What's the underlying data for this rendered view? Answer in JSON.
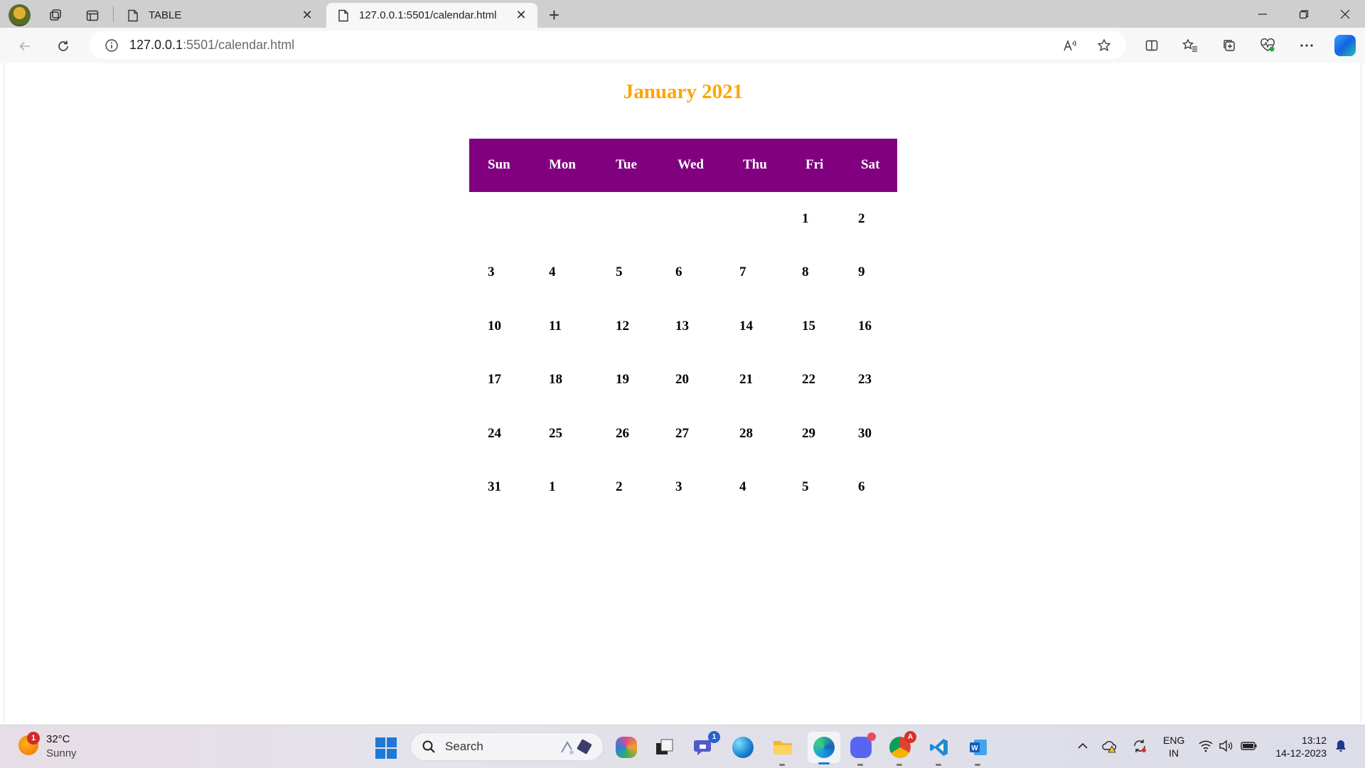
{
  "browser": {
    "tabs": [
      {
        "title": "TABLE",
        "active": false
      },
      {
        "title": "127.0.0.1:5501/calendar.html",
        "active": true
      }
    ],
    "url_host": "127.0.0.1",
    "url_path": ":5501/calendar.html"
  },
  "calendar": {
    "title": "January 2021",
    "header_color": "#800080",
    "title_color": "#ffa500",
    "weekdays": [
      "Sun",
      "Mon",
      "Tue",
      "Wed",
      "Thu",
      "Fri",
      "Sat"
    ],
    "weeks": [
      [
        "",
        "",
        "",
        "",
        "",
        "1",
        "2"
      ],
      [
        "3",
        "4",
        "5",
        "6",
        "7",
        "8",
        "9"
      ],
      [
        "10",
        "11",
        "12",
        "13",
        "14",
        "15",
        "16"
      ],
      [
        "17",
        "18",
        "19",
        "20",
        "21",
        "22",
        "23"
      ],
      [
        "24",
        "25",
        "26",
        "27",
        "28",
        "29",
        "30"
      ],
      [
        "31",
        "1",
        "2",
        "3",
        "4",
        "5",
        "6"
      ]
    ]
  },
  "taskbar": {
    "weather_temp": "32°C",
    "weather_desc": "Sunny",
    "weather_badge": "1",
    "search_label": "Search",
    "teams_badge": "1",
    "language_line1": "ENG",
    "language_line2": "IN",
    "time": "13:12",
    "date": "14-12-2023"
  }
}
